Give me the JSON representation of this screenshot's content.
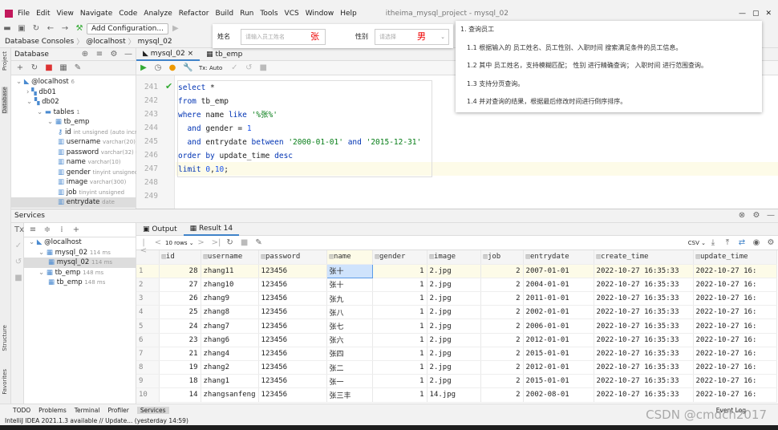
{
  "menu": [
    "File",
    "Edit",
    "View",
    "Navigate",
    "Code",
    "Analyze",
    "Refactor",
    "Build",
    "Run",
    "Tools",
    "VCS",
    "Window",
    "Help"
  ],
  "window_title": "itheima_mysql_project - mysql_02",
  "toolbar": {
    "add_config": "Add Configuration..."
  },
  "breadcrumb": [
    "Database Consoles",
    "@localhost",
    "mysql_02"
  ],
  "stripe": {
    "project": "Project",
    "database": "Database",
    "structure": "Structure",
    "favorites": "Favorites"
  },
  "db_panel": {
    "title": "Database",
    "tree": [
      {
        "label": "@localhost",
        "meta": "6",
        "indent": 0,
        "icon": "datasource-icon"
      },
      {
        "label": "db01",
        "meta": "",
        "indent": 1,
        "icon": "schema-icon"
      },
      {
        "label": "db02",
        "meta": "",
        "indent": 1,
        "icon": "schema-icon"
      },
      {
        "label": "tables",
        "meta": "1",
        "indent": 2,
        "icon": "folder-icon"
      },
      {
        "label": "tb_emp",
        "meta": "",
        "indent": 3,
        "icon": "table-icon"
      },
      {
        "label": "id",
        "meta": "int unsigned (auto incre",
        "indent": 4,
        "icon": "key-column-icon"
      },
      {
        "label": "username",
        "meta": "varchar(20)",
        "indent": 4,
        "icon": "column-icon"
      },
      {
        "label": "password",
        "meta": "varchar(32) =",
        "indent": 4,
        "icon": "column-icon"
      },
      {
        "label": "name",
        "meta": "varchar(10)",
        "indent": 4,
        "icon": "column-icon"
      },
      {
        "label": "gender",
        "meta": "tinyint unsigned",
        "indent": 4,
        "icon": "column-icon"
      },
      {
        "label": "image",
        "meta": "varchar(300)",
        "indent": 4,
        "icon": "column-icon"
      },
      {
        "label": "job",
        "meta": "tinyint unsigned",
        "indent": 4,
        "icon": "column-icon"
      },
      {
        "label": "entrydate",
        "meta": "date",
        "indent": 4,
        "icon": "column-icon"
      }
    ]
  },
  "editor": {
    "tabs": [
      "mysql_02",
      "tb_emp"
    ],
    "tx": "Tx: Auto",
    "line_numbers": [
      "241",
      "242",
      "243",
      "244",
      "245",
      "246",
      "247",
      "248",
      "249"
    ]
  },
  "form": {
    "name_label": "姓名",
    "name_placeholder": "请输入员工姓名",
    "name_value": "张",
    "gender_label": "性别",
    "gender_placeholder": "请选择",
    "gender_value": "男"
  },
  "notes": [
    "1. 查询员工",
    "1.1 根据输入的 员工姓名、员工性别、入职时间 搜索满足条件的员工信息。",
    "1.2 其中 员工姓名，支持模糊匹配； 性别 进行精确查询； 入职时间 进行范围查询。",
    "1.3 支持分页查询。",
    "1.4 并对查询的结果，根据最后修改时间进行倒序排序。"
  ],
  "services": {
    "title": "Services",
    "tree": [
      {
        "label": "@localhost",
        "meta": "",
        "indent": 0
      },
      {
        "label": "mysql_02",
        "meta": "114 ms",
        "indent": 1
      },
      {
        "label": "mysql_02",
        "meta": "114 ms",
        "indent": 2
      },
      {
        "label": "tb_emp",
        "meta": "148 ms",
        "indent": 1
      },
      {
        "label": "tb_emp",
        "meta": "148 ms",
        "indent": 2
      }
    ],
    "tabs": [
      "Output",
      "Result 14"
    ],
    "rows_select": "10 rows",
    "export": "CSV"
  },
  "table": {
    "columns": [
      "id",
      "username",
      "password",
      "name",
      "gender",
      "image",
      "job",
      "entrydate",
      "create_time",
      "update_time"
    ],
    "rows": [
      [
        "1",
        "28",
        "zhang11",
        "123456",
        "张十",
        "1",
        "2.jpg",
        "2",
        "2007-01-01",
        "2022-10-27 16:35:33",
        "2022-10-27 16:"
      ],
      [
        "2",
        "27",
        "zhang10",
        "123456",
        "张十",
        "1",
        "2.jpg",
        "2",
        "2004-01-01",
        "2022-10-27 16:35:33",
        "2022-10-27 16:"
      ],
      [
        "3",
        "26",
        "zhang9",
        "123456",
        "张九",
        "1",
        "2.jpg",
        "2",
        "2011-01-01",
        "2022-10-27 16:35:33",
        "2022-10-27 16:"
      ],
      [
        "4",
        "25",
        "zhang8",
        "123456",
        "张八",
        "1",
        "2.jpg",
        "2",
        "2002-01-01",
        "2022-10-27 16:35:33",
        "2022-10-27 16:"
      ],
      [
        "5",
        "24",
        "zhang7",
        "123456",
        "张七",
        "1",
        "2.jpg",
        "2",
        "2006-01-01",
        "2022-10-27 16:35:33",
        "2022-10-27 16:"
      ],
      [
        "6",
        "23",
        "zhang6",
        "123456",
        "张六",
        "1",
        "2.jpg",
        "2",
        "2012-01-01",
        "2022-10-27 16:35:33",
        "2022-10-27 16:"
      ],
      [
        "7",
        "21",
        "zhang4",
        "123456",
        "张四",
        "1",
        "2.jpg",
        "2",
        "2015-01-01",
        "2022-10-27 16:35:33",
        "2022-10-27 16:"
      ],
      [
        "8",
        "19",
        "zhang2",
        "123456",
        "张二",
        "1",
        "2.jpg",
        "2",
        "2012-01-01",
        "2022-10-27 16:35:33",
        "2022-10-27 16:"
      ],
      [
        "9",
        "18",
        "zhang1",
        "123456",
        "张一",
        "1",
        "2.jpg",
        "2",
        "2015-01-01",
        "2022-10-27 16:35:33",
        "2022-10-27 16:"
      ],
      [
        "10",
        "14",
        "zhangsanfeng",
        "123456",
        "张三丰",
        "1",
        "14.jpg",
        "2",
        "2002-08-01",
        "2022-10-27 16:35:33",
        "2022-10-27 16:"
      ]
    ]
  },
  "bottom_tabs": [
    "TODO",
    "Problems",
    "Terminal",
    "Profiler",
    "Services"
  ],
  "event_log": "Event Log",
  "status": "IntelliJ IDEA 2021.1.3 available // Update... (yesterday 14:59)",
  "watermark": "CSDN @cmdch2017"
}
